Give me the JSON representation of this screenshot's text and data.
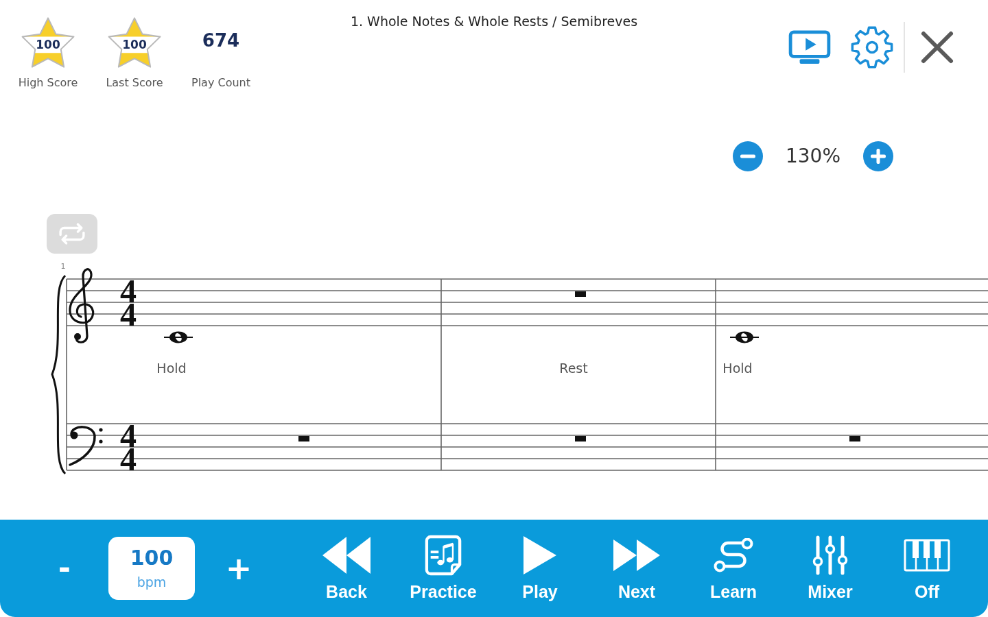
{
  "header": {
    "stats": [
      {
        "kind": "star",
        "value": "100",
        "label": "High Score"
      },
      {
        "kind": "star",
        "value": "100",
        "label": "Last Score"
      },
      {
        "kind": "count",
        "value": "674",
        "label": "Play Count"
      }
    ],
    "title": "1. Whole Notes & Whole Rests / Semibreves"
  },
  "zoom": {
    "value": "130%"
  },
  "score": {
    "measure_number": "1",
    "staves": [
      {
        "kind": "treble",
        "time_signature": [
          "4",
          "4"
        ]
      },
      {
        "kind": "bass",
        "time_signature": [
          "4",
          "4"
        ]
      }
    ],
    "measures": [
      {
        "notes": [
          {
            "kind": "whole_note"
          },
          {
            "kind": "whole_rest"
          }
        ],
        "label": "Hold"
      },
      {
        "notes": [
          {
            "kind": "whole_rest"
          },
          {
            "kind": "whole_rest"
          }
        ],
        "label": "Rest"
      },
      {
        "notes": [
          {
            "kind": "whole_note"
          },
          {
            "kind": "whole_rest"
          }
        ],
        "label": "Hold"
      }
    ]
  },
  "toolbar": {
    "tempo": {
      "decrease": "-",
      "value": "100",
      "unit": "bpm",
      "increase": "+"
    },
    "buttons": [
      {
        "kind": "back",
        "label": "Back"
      },
      {
        "kind": "practice",
        "label": "Practice"
      },
      {
        "kind": "play",
        "label": "Play"
      },
      {
        "kind": "next",
        "label": "Next"
      },
      {
        "kind": "learn",
        "label": "Learn"
      },
      {
        "kind": "mixer",
        "label": "Mixer"
      },
      {
        "kind": "keyboard",
        "label": "Off"
      }
    ]
  }
}
